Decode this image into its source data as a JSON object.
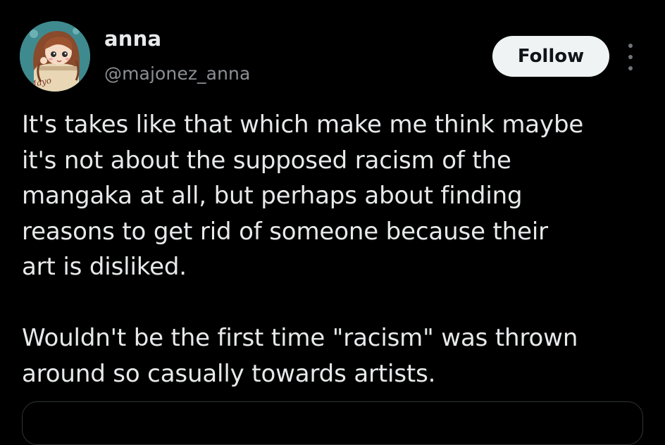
{
  "author": {
    "display_name": "anna",
    "handle": "@majonez_anna",
    "avatar_icon": "avatar-illustration-icon",
    "avatar_text": "Mayo"
  },
  "actions": {
    "follow_label": "Follow",
    "more_icon": "more-vertical-icon"
  },
  "tweet": {
    "paragraphs": [
      "It's takes like that which make me think maybe it's not about the supposed racism of the mangaka at all, but perhaps about finding reasons to get rid of someone because their art is disliked.",
      "Wouldn't be the first time \"racism\" was thrown around so casually towards artists."
    ],
    "lines_p1": [
      "It's takes like that which make me think maybe",
      "it's not about the supposed racism of the",
      "mangaka at all, but perhaps about finding",
      "reasons to get rid of someone because their",
      "art is disliked."
    ],
    "lines_p2": [
      "Wouldn't be the first time \"racism\" was thrown",
      "around so casually towards artists."
    ]
  },
  "colors": {
    "background": "#000000",
    "primary_text": "#e7e9ea",
    "secondary_text": "#8b8f94",
    "follow_bg": "#eff3f4",
    "follow_text": "#0f1419"
  }
}
